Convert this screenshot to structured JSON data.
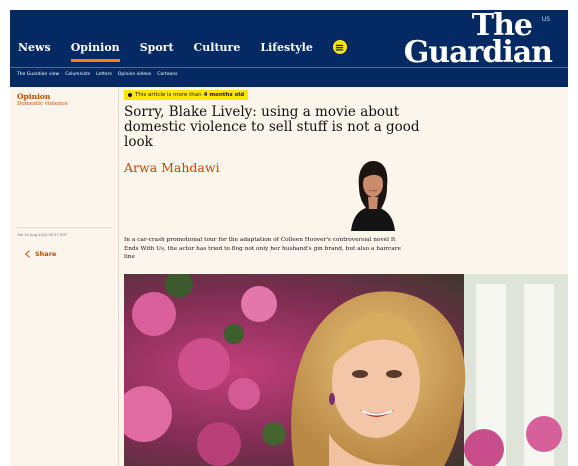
{
  "header": {
    "nav": [
      {
        "label": "News",
        "active": false
      },
      {
        "label": "Opinion",
        "active": true
      },
      {
        "label": "Sport",
        "active": false
      },
      {
        "label": "Culture",
        "active": false
      },
      {
        "label": "Lifestyle",
        "active": false
      }
    ],
    "edition": "US",
    "logo_line1": "The",
    "logo_line2": "Guardian",
    "colors": {
      "brand": "#052962",
      "accent": "#ff7f0f",
      "highlight": "#ffe500"
    }
  },
  "subnav": [
    "The Guardian view",
    "Columnists",
    "Letters",
    "Opinion videos",
    "Cartoons"
  ],
  "article": {
    "section": "Opinion",
    "subsection": "Domestic violence",
    "age_notice_prefix": "This article is more than",
    "age_notice_bold": "4 months old",
    "headline": "Sorry, Blake Lively: using a movie about domestic violence to sell stuff is not a good look",
    "byline": "Arwa Mahdawi",
    "timestamp": "Tue 20 Aug 2024 09.37 EDT",
    "share_label": "Share",
    "standfirst": "In a car-crash promotional tour for the adaptation of Colleen Hoover's controversial novel It Ends With Us, the actor has tried to flog not only her husband's gin brand, but also a haircare line",
    "section_color": "#c74600"
  }
}
